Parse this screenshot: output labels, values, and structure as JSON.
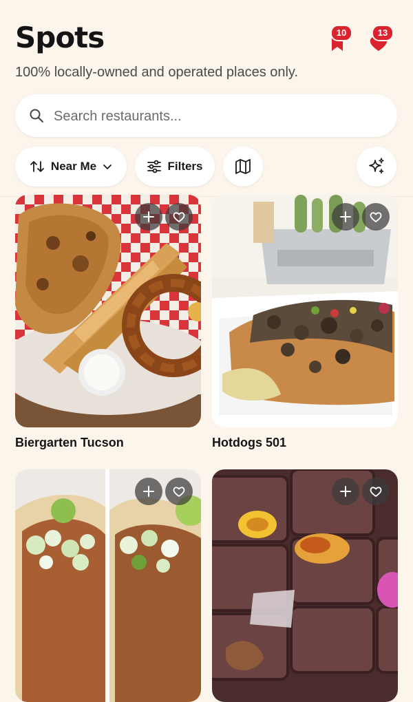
{
  "header": {
    "title": "Spots",
    "subtitle": "100% locally-owned and operated places only.",
    "saved_count": "10",
    "liked_count": "13"
  },
  "search": {
    "placeholder": "Search restaurants..."
  },
  "filters": {
    "sort_label": "Near Me",
    "filters_label": "Filters"
  },
  "icons": {
    "sort": "sort-arrows-icon",
    "chevron": "chevron-down-icon",
    "filters": "sliders-icon",
    "map": "map-icon",
    "ai": "sparkles-icon",
    "add": "plus-icon",
    "favorite": "heart-outline-icon"
  },
  "colors": {
    "accent": "#D9232E",
    "background": "#FBF5EC"
  },
  "spots": [
    {
      "name": "Biergarten Tucson"
    },
    {
      "name": "Hotdogs 501"
    },
    {
      "name": ""
    },
    {
      "name": ""
    }
  ]
}
